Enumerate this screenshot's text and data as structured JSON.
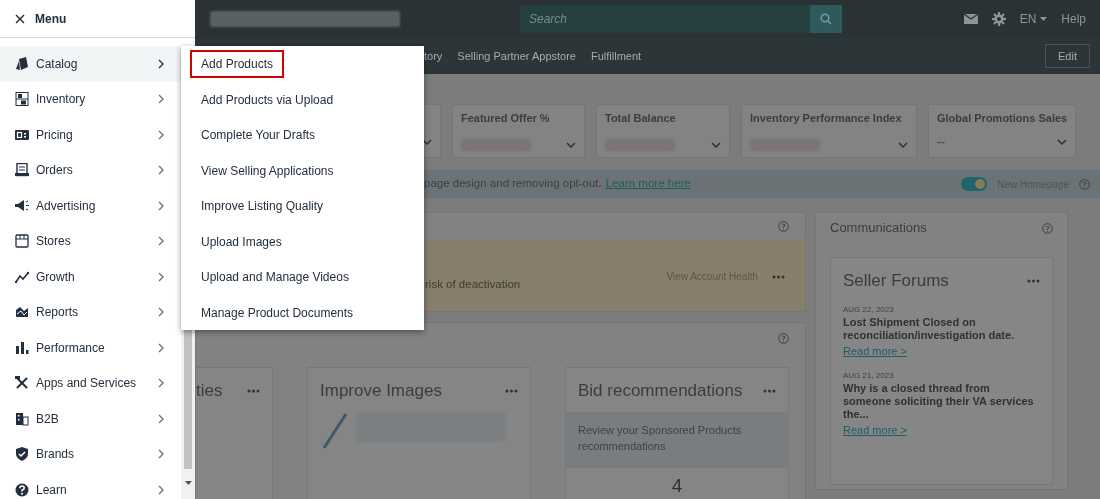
{
  "sidebar": {
    "title": "Menu",
    "items": [
      {
        "label": "Catalog",
        "selected": true
      },
      {
        "label": "Inventory",
        "selected": false
      },
      {
        "label": "Pricing",
        "selected": false
      },
      {
        "label": "Orders",
        "selected": false
      },
      {
        "label": "Advertising",
        "selected": false
      },
      {
        "label": "Stores",
        "selected": false
      },
      {
        "label": "Growth",
        "selected": false
      },
      {
        "label": "Reports",
        "selected": false
      },
      {
        "label": "Performance",
        "selected": false
      },
      {
        "label": "Apps and Services",
        "selected": false
      },
      {
        "label": "B2B",
        "selected": false
      },
      {
        "label": "Brands",
        "selected": false
      },
      {
        "label": "Learn",
        "selected": false
      }
    ]
  },
  "flyout": {
    "items": [
      {
        "label": "Add Products",
        "selected": true
      },
      {
        "label": "Add Products via Upload",
        "selected": false
      },
      {
        "label": "Complete Your Drafts",
        "selected": false
      },
      {
        "label": "View Selling Applications",
        "selected": false
      },
      {
        "label": "Improve Listing Quality",
        "selected": false
      },
      {
        "label": "Upload Images",
        "selected": false
      },
      {
        "label": "Upload and Manage Videos",
        "selected": false
      },
      {
        "label": "Manage Product Documents",
        "selected": false
      }
    ]
  },
  "topbar": {
    "search": {
      "placeholder": "Search"
    },
    "language": "EN",
    "help": "Help"
  },
  "nav": {
    "items": [
      "tory",
      "Selling Partner Appstore",
      "Fulfillment"
    ],
    "edit": "Edit"
  },
  "metrics": [
    {
      "title": "Featured Offer %"
    },
    {
      "title": "Total Balance"
    },
    {
      "title": "Inventory Performance Index"
    },
    {
      "title": "Global Promotions Sales",
      "value": "--"
    }
  ],
  "banner": {
    "text": "page design and removing opt-out.",
    "link": "Learn more here",
    "toggle": {
      "label": "New Homepage",
      "on": true
    }
  },
  "alert": {
    "text": "risk of deactivation",
    "link": "View Account Health"
  },
  "widgets": [
    {
      "title": "ties"
    },
    {
      "title": "Improve Images"
    },
    {
      "title": "Bid recommendations",
      "text": "Review your Sponsored Products recommendations",
      "count": "4"
    }
  ],
  "communications": {
    "title": "Communications",
    "forum": {
      "title": "Seller Forums",
      "posts": [
        {
          "date": "AUG 22, 2023",
          "title": "Lost Shipment Closed on reconciliation/investigation date.",
          "link": "Read more >"
        },
        {
          "date": "AUG 21, 2023",
          "title": "Why is a closed thread from someone soliciting their VA services the...",
          "link": "Read more >"
        }
      ]
    }
  }
}
